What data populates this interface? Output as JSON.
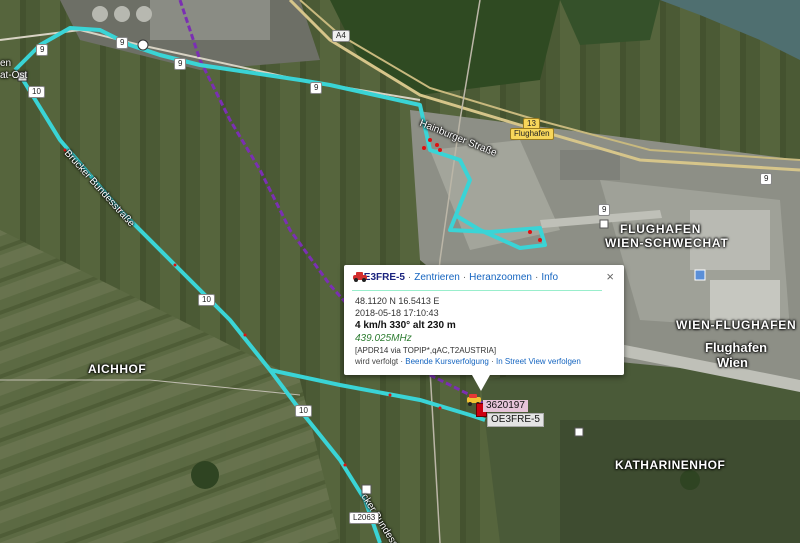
{
  "map": {
    "places": {
      "aichhof": "AICHHOF",
      "katharinenhof": "KATHARINENHOF",
      "flughafen_wien_schwechat_1": "FLUGHAFEN",
      "flughafen_wien_schwechat_2": "WIEN-SCHWECHAT",
      "wien_flughafen": "WIEN-FLUGHAFEN",
      "flughafen_wien_1": "Flughafen",
      "flughafen_wien_2": "Wien",
      "left_edge_1": "en",
      "left_edge_2": "at-Ost"
    },
    "streets": {
      "hainburger": "Hainburger Straße",
      "bruck": "Brucker Bundesstraße",
      "bruck_lower": "cker Bundesst"
    },
    "shields": {
      "a4": "A4",
      "r9a": "9",
      "r9b": "9",
      "r9c": "9",
      "r9d": "9",
      "r9e": "9",
      "r9f": "9",
      "r10a": "10",
      "r10b": "10",
      "r10c": "10",
      "r13": "13",
      "flughafen": "Flughafen",
      "l2063": "L2063"
    },
    "colors": {
      "track": "#3ad4d6",
      "path": "#7b2fb3",
      "popup_rule": "#99e0cc"
    }
  },
  "popup": {
    "callsign": "OE3FRE-5",
    "links": [
      "Zentrieren",
      "Heranzoomen",
      "Info"
    ],
    "coords": "48.1120 N 16.5413 E",
    "timestamp": "2018-05-18 17:10:43",
    "motion": "4 km/h 330° alt 230 m",
    "frequency": "439.025MHz",
    "path": "[APDR14 via TOPIP*,qAC,T2AUSTRIA]",
    "follow_prefix": "wird verfolgt ·",
    "follow_stop": "Beende Kursverfolgung",
    "follow_sep": "·",
    "street_view": "In Street View verfolgen",
    "close": "×"
  },
  "markers": {
    "ssid_tag": "3620197",
    "name_tag": "OE3FRE-5"
  }
}
